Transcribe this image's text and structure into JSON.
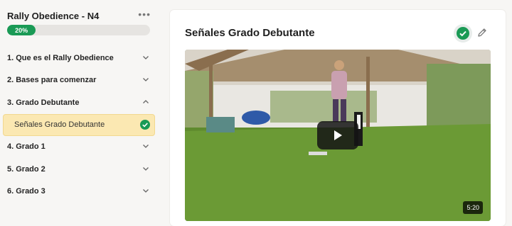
{
  "sidebar": {
    "course_title": "Rally Obedience - N4",
    "more_icon": "more-horizontal-icon",
    "progress": {
      "label": "20%",
      "fraction": 0.2
    },
    "sections": [
      {
        "label": "1. Que es el Rally Obedience",
        "expanded": false
      },
      {
        "label": "2. Bases para comenzar",
        "expanded": false
      },
      {
        "label": "3. Grado Debutante",
        "expanded": true
      },
      {
        "label": "4. Grado 1",
        "expanded": false
      },
      {
        "label": "5. Grado 2",
        "expanded": false
      },
      {
        "label": "6. Grado 3",
        "expanded": false
      }
    ],
    "active_lesson": {
      "label": "Señales Grado Debutante",
      "completed": true
    }
  },
  "lesson": {
    "title": "Señales Grado Debutante",
    "complete_icon": "check-circle-icon",
    "edit_icon": "pencil-icon"
  },
  "video": {
    "duration": "5:20",
    "play_icon": "play-icon"
  },
  "colors": {
    "accent_green": "#1a9a55",
    "active_bg": "#fbe8b2"
  }
}
